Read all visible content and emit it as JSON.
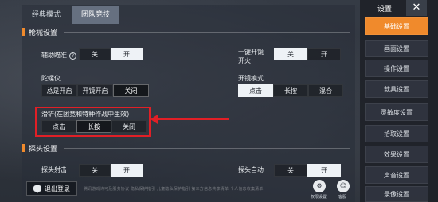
{
  "mode_tabs": [
    {
      "label": "经典模式",
      "active": false
    },
    {
      "label": "团队竞技",
      "active": true
    }
  ],
  "sections": {
    "firearm": "枪械设置",
    "peek": "探头设置"
  },
  "settings": {
    "assist_aim": {
      "label": "辅助瞄准",
      "options": [
        "关",
        "开"
      ],
      "selected": "开"
    },
    "one_key_scope": {
      "label": "一键开镜开火",
      "options": [
        "关",
        "开"
      ],
      "selected": "关"
    },
    "gyroscope": {
      "label": "陀螺仪",
      "options": [
        "总是开启",
        "开镜开启",
        "关闭"
      ],
      "selected": "关闭"
    },
    "scope_mode": {
      "label": "开镜模式",
      "options": [
        "点击",
        "长按",
        "混合"
      ],
      "selected": "点击"
    },
    "slide": {
      "label": "滑铲(在团竞和特种作战中生效)",
      "options": [
        "点击",
        "长按",
        "关闭"
      ],
      "selected": "长按"
    },
    "peek_shoot": {
      "label": "探头射击",
      "options": [
        "关",
        "开"
      ],
      "selected": "开"
    },
    "peek_auto": {
      "label": "探头自动",
      "options": [
        "关",
        "开"
      ],
      "selected": "开"
    }
  },
  "logout_label": "退出登录",
  "footer_text": "腾讯游戏许可及服务协议   隐私保护指引   儿童隐私保护指引   第三方信息共享清单   个人信息收集清单",
  "bottom_buttons": [
    {
      "label": "权限设置",
      "icon": "gear-icon",
      "glyph": "⚙"
    },
    {
      "label": "客服",
      "icon": "headset-icon",
      "glyph": "☺"
    }
  ],
  "sidebar": {
    "title": "设置",
    "close": "✕",
    "items": [
      {
        "label": "基础设置",
        "active": true
      },
      {
        "label": "画面设置",
        "active": false
      },
      {
        "label": "操作设置",
        "active": false
      },
      {
        "label": "载具设置",
        "active": false
      },
      {
        "label": "灵敏度设置",
        "active": false
      },
      {
        "label": "拾取设置",
        "active": false
      },
      {
        "label": "效果设置",
        "active": false
      },
      {
        "label": "声音设置",
        "active": false
      },
      {
        "label": "录像设置",
        "active": false
      }
    ]
  },
  "colors": {
    "accent": "#f08a2c",
    "highlight": "#e11f26"
  }
}
